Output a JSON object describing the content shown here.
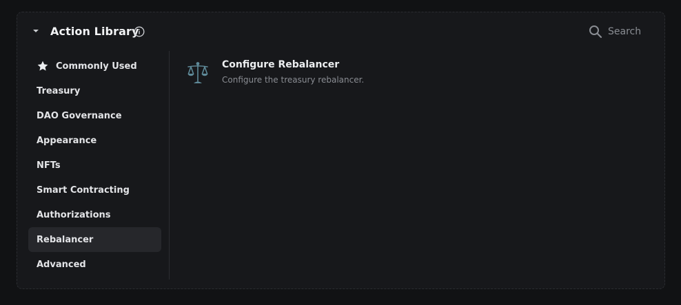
{
  "header": {
    "title": "Action Library",
    "search_placeholder": "Search"
  },
  "sidebar": {
    "items": [
      {
        "label": "Commonly Used",
        "icon": "star-icon"
      },
      {
        "label": "Treasury"
      },
      {
        "label": "DAO Governance"
      },
      {
        "label": "Appearance"
      },
      {
        "label": "NFTs"
      },
      {
        "label": "Smart Contracting"
      },
      {
        "label": "Authorizations"
      },
      {
        "label": "Rebalancer",
        "active": true
      },
      {
        "label": "Advanced"
      }
    ]
  },
  "actions": [
    {
      "title": "Configure Rebalancer",
      "description": "Configure the treasury rebalancer.",
      "icon": "scales-icon"
    }
  ],
  "colors": {
    "background": "#111214",
    "panel": "#17181b",
    "active_item": "#26272b",
    "muted_text": "#8a8d93",
    "icon_accent": "#5f8a99"
  }
}
